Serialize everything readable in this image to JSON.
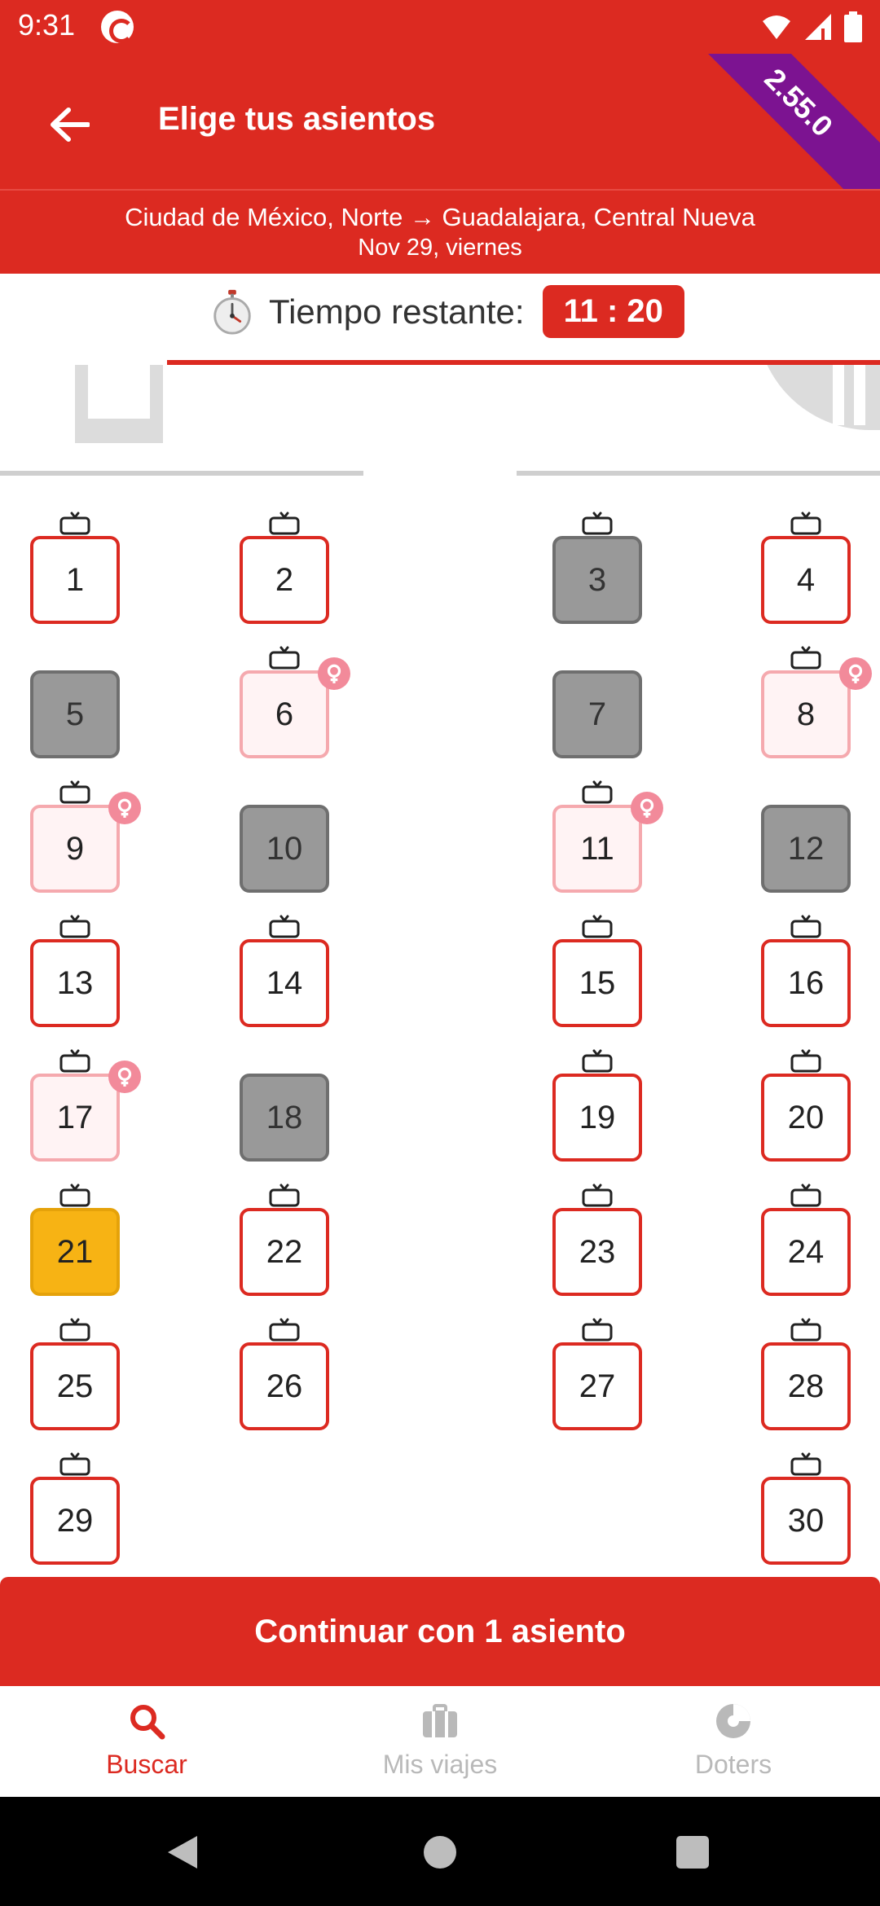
{
  "status_bar": {
    "time": "9:31"
  },
  "header": {
    "title": "Elige tus asientos",
    "version": "2.55.0"
  },
  "trip": {
    "route": "Ciudad de México, Norte → Guadalajara, Central Nueva",
    "date": "Nov 29, viernes"
  },
  "timer": {
    "label": "Tiempo restante:",
    "value": "11 : 20"
  },
  "seats": [
    {
      "number": "1",
      "status": "available",
      "tv": true,
      "women_only": false
    },
    {
      "number": "2",
      "status": "available",
      "tv": true,
      "women_only": false
    },
    {
      "number": "3",
      "status": "taken",
      "tv": true,
      "women_only": false
    },
    {
      "number": "4",
      "status": "available",
      "tv": true,
      "women_only": false
    },
    {
      "number": "5",
      "status": "taken",
      "tv": false,
      "women_only": false
    },
    {
      "number": "6",
      "status": "women",
      "tv": true,
      "women_only": true
    },
    {
      "number": "7",
      "status": "taken",
      "tv": false,
      "women_only": false
    },
    {
      "number": "8",
      "status": "women",
      "tv": true,
      "women_only": true
    },
    {
      "number": "9",
      "status": "women",
      "tv": true,
      "women_only": true
    },
    {
      "number": "10",
      "status": "taken",
      "tv": false,
      "women_only": false
    },
    {
      "number": "11",
      "status": "women",
      "tv": true,
      "women_only": true
    },
    {
      "number": "12",
      "status": "taken",
      "tv": false,
      "women_only": false
    },
    {
      "number": "13",
      "status": "available",
      "tv": true,
      "women_only": false
    },
    {
      "number": "14",
      "status": "available",
      "tv": true,
      "women_only": false
    },
    {
      "number": "15",
      "status": "available",
      "tv": true,
      "women_only": false
    },
    {
      "number": "16",
      "status": "available",
      "tv": true,
      "women_only": false
    },
    {
      "number": "17",
      "status": "women",
      "tv": true,
      "women_only": true
    },
    {
      "number": "18",
      "status": "taken",
      "tv": false,
      "women_only": false
    },
    {
      "number": "19",
      "status": "available",
      "tv": true,
      "women_only": false
    },
    {
      "number": "20",
      "status": "available",
      "tv": true,
      "women_only": false
    },
    {
      "number": "21",
      "status": "selected",
      "tv": true,
      "women_only": false
    },
    {
      "number": "22",
      "status": "available",
      "tv": true,
      "women_only": false
    },
    {
      "number": "23",
      "status": "available",
      "tv": true,
      "women_only": false
    },
    {
      "number": "24",
      "status": "available",
      "tv": true,
      "women_only": false
    },
    {
      "number": "25",
      "status": "available",
      "tv": true,
      "women_only": false
    },
    {
      "number": "26",
      "status": "available",
      "tv": true,
      "women_only": false
    },
    {
      "number": "27",
      "status": "available",
      "tv": true,
      "women_only": false
    },
    {
      "number": "28",
      "status": "available",
      "tv": true,
      "women_only": false
    },
    {
      "number": "29",
      "status": "available",
      "tv": true,
      "women_only": false
    },
    {
      "number": "30",
      "status": "available",
      "tv": true,
      "women_only": false
    }
  ],
  "continue_button": {
    "label": "Continuar con 1 asiento"
  },
  "bottom_nav": [
    {
      "label": "Buscar",
      "icon": "search-icon",
      "active": true
    },
    {
      "label": "Mis viajes",
      "icon": "briefcase-icon",
      "active": false
    },
    {
      "label": "Doters",
      "icon": "doters-icon",
      "active": false
    }
  ],
  "colors": {
    "brand_red": "#dc2a21",
    "selected_yellow": "#f7b314",
    "taken_gray": "#999999",
    "women_pink": "#f28a9a",
    "ribbon_purple": "#7c1391"
  }
}
